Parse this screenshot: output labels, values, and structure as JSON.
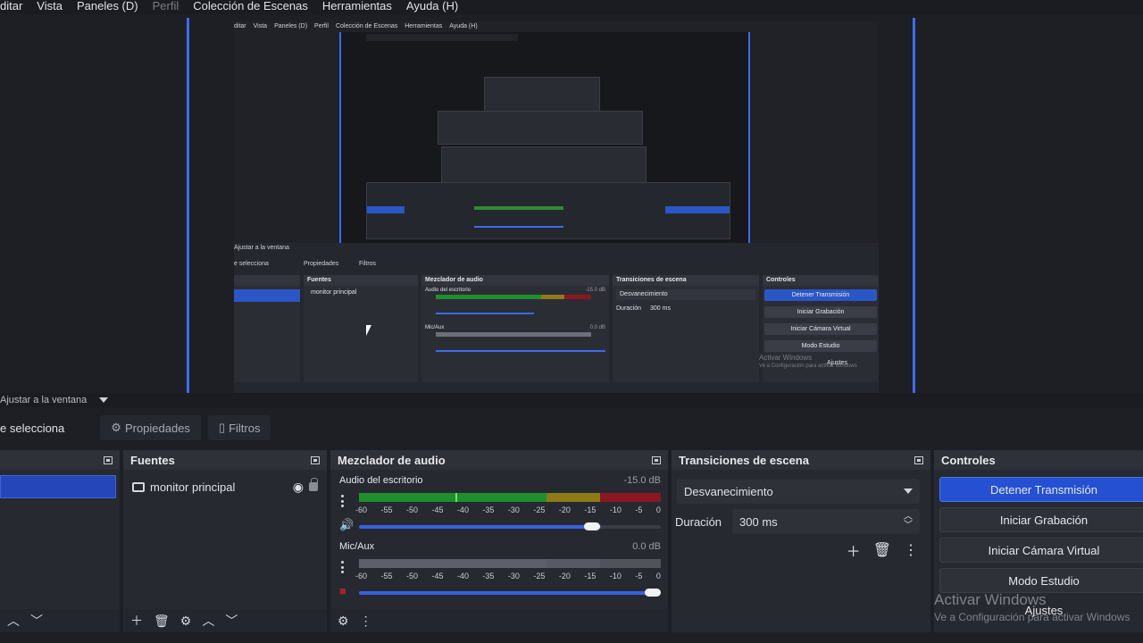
{
  "menu": {
    "items": [
      {
        "label": "ditar",
        "disabled": false
      },
      {
        "label": "Vista",
        "disabled": false
      },
      {
        "label": "Paneles (D)",
        "disabled": false
      },
      {
        "label": "Perfil",
        "disabled": true
      },
      {
        "label": "Colección de Escenas",
        "disabled": false
      },
      {
        "label": "Herramientas",
        "disabled": false
      },
      {
        "label": "Ayuda (H)",
        "disabled": false
      }
    ]
  },
  "nested": {
    "menu": [
      "ditar",
      "Vista",
      "Paneles (D)",
      "Perfil",
      "Colección de Escenas",
      "Herramientas",
      "Ayuda (H)"
    ],
    "ajustar": "Ajustar a la ventana",
    "seleccion": "e selecciona",
    "propiedades": "Propiedades",
    "filtros": "Filtros",
    "fuentes": "Fuentes",
    "source": "monitor principal",
    "mezclador": "Mezclador de audio",
    "audio_escritorio": "Audio del escritorio",
    "audio_db": "-15.0 dB",
    "mic": "Mic/Aux",
    "mic_db": "0.0 dB",
    "transiciones": "Transiciones de escena",
    "desvanecimiento": "Desvanecimiento",
    "duracion": "Duración",
    "ms": "300 ms",
    "controles": "Controles",
    "detener": "Detener Transmisión",
    "grabacion": "Iniciar Grabación",
    "camara": "Iniciar Cámara Virtual",
    "estudio": "Modo Estudio",
    "ajustes": "Ajustes",
    "wm1": "Activar Windows",
    "wm2": "Ve a Configuración para activar Windows"
  },
  "preview": {
    "fit_label": "Ajustar a la ventana"
  },
  "toolbar": {
    "selection_label": "e selecciona",
    "properties_label": "Propiedades",
    "filters_label": "Filtros"
  },
  "sources_panel": {
    "title": "Fuentes",
    "items": [
      {
        "label": "monitor principal"
      }
    ]
  },
  "mixer": {
    "title": "Mezclador de audio",
    "ticks": [
      "-60",
      "-55",
      "-50",
      "-45",
      "-40",
      "-35",
      "-30",
      "-25",
      "-20",
      "-15",
      "-10",
      "-5",
      "0"
    ],
    "channels": [
      {
        "name": "Audio del escritorio",
        "db": "-15.0 dB",
        "volume": 0.8
      },
      {
        "name": "Mic/Aux",
        "db": "0.0 dB",
        "volume": 1.0
      }
    ]
  },
  "transitions": {
    "title": "Transiciones de escena",
    "selected": "Desvanecimiento",
    "duration_label": "Duración",
    "duration_value": "300 ms"
  },
  "controls": {
    "title": "Controles",
    "stop_stream": "Detener Transmisión",
    "start_recording": "Iniciar Grabación",
    "start_virtual_cam": "Iniciar Cámara Virtual",
    "studio_mode": "Modo Estudio",
    "settings": "Ajustes"
  },
  "watermark": {
    "line1": "Activar Windows",
    "line2": "Ve a Configuración para activar Windows"
  },
  "colors": {
    "accent": "#2450d1",
    "meter_green": "#1e8f2c",
    "meter_yellow": "#8d7b18",
    "meter_red": "#8a1722"
  }
}
